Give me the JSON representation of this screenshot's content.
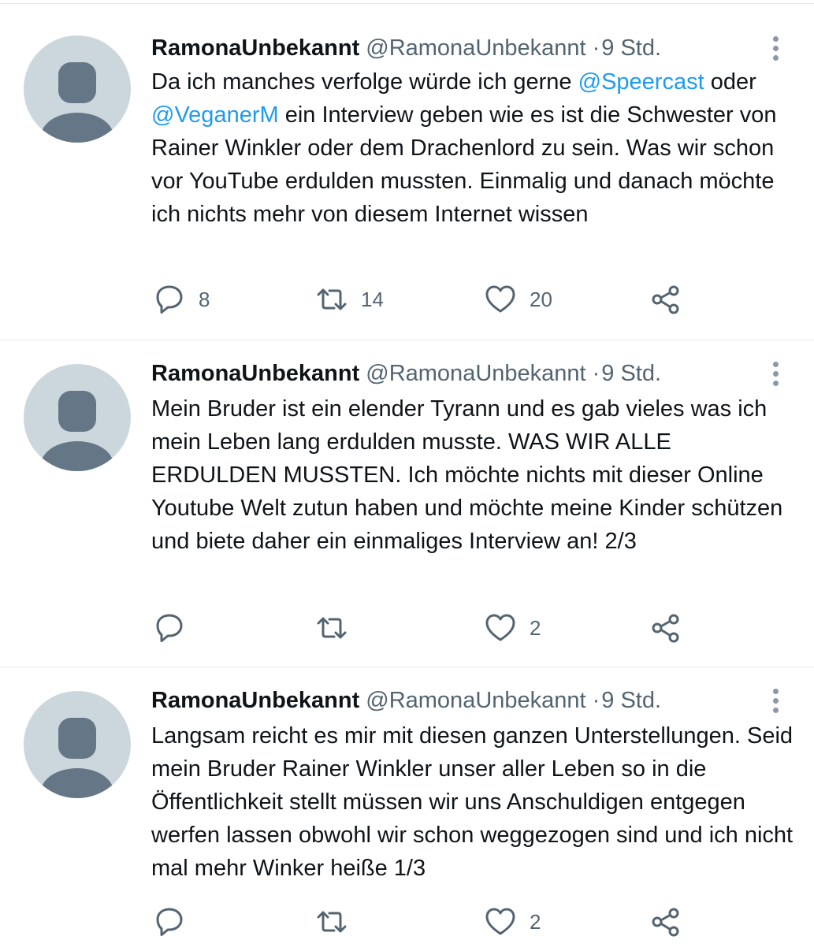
{
  "tweets": [
    {
      "display_name": "RamonaUnbekannt",
      "handle": "@RamonaUnbekannt",
      "separator": "·",
      "timestamp": "9 Std.",
      "text_parts": [
        "Da ich manches verfolge würde ich gerne ",
        "@Speercast",
        " oder ",
        "@VeganerM",
        " ein Interview geben wie es ist die Schwester von Rainer Winkler oder dem Drachenlord zu sein. Was wir schon vor YouTube erdulden mussten. Einmalig und danach möchte ich nichts mehr von diesem Internet wissen"
      ],
      "reply_count": "8",
      "retweet_count": "14",
      "like_count": "20",
      "icons": {
        "reply": "reply-icon",
        "retweet": "retweet-icon",
        "like": "heart-icon",
        "share": "share-icon"
      }
    },
    {
      "display_name": "RamonaUnbekannt",
      "handle": "@RamonaUnbekannt",
      "separator": "·",
      "timestamp": "9 Std.",
      "text": "Mein Bruder ist ein elender Tyrann und es gab vieles was ich mein Leben lang erdulden musste. WAS WIR ALLE ERDULDEN MUSSTEN. Ich möchte nichts mit dieser Online Youtube Welt zutun haben und möchte meine Kinder schützen und biete daher ein einmaliges Interview an! 2/3",
      "reply_count": "",
      "retweet_count": "",
      "like_count": "2"
    },
    {
      "display_name": "RamonaUnbekannt",
      "handle": "@RamonaUnbekannt",
      "separator": "·",
      "timestamp": "9 Std.",
      "text": "Langsam reicht es mir mit diesen ganzen Unterstellungen. Seid mein Bruder Rainer Winkler unser aller Leben so in die Öffentlichkeit stellt müssen wir uns Anschuldigen entgegen werfen lassen obwohl wir schon weggezogen sind und ich nicht mal mehr Winker heiße 1/3",
      "reply_count": "",
      "retweet_count": "",
      "like_count": "2"
    }
  ],
  "colors": {
    "text_primary": "#0f1419",
    "text_secondary": "#536471",
    "mention": "#1d9bf0",
    "avatar_bg": "#ccd6dd",
    "avatar_figure": "#657786",
    "divider": "#e6e9ec"
  }
}
